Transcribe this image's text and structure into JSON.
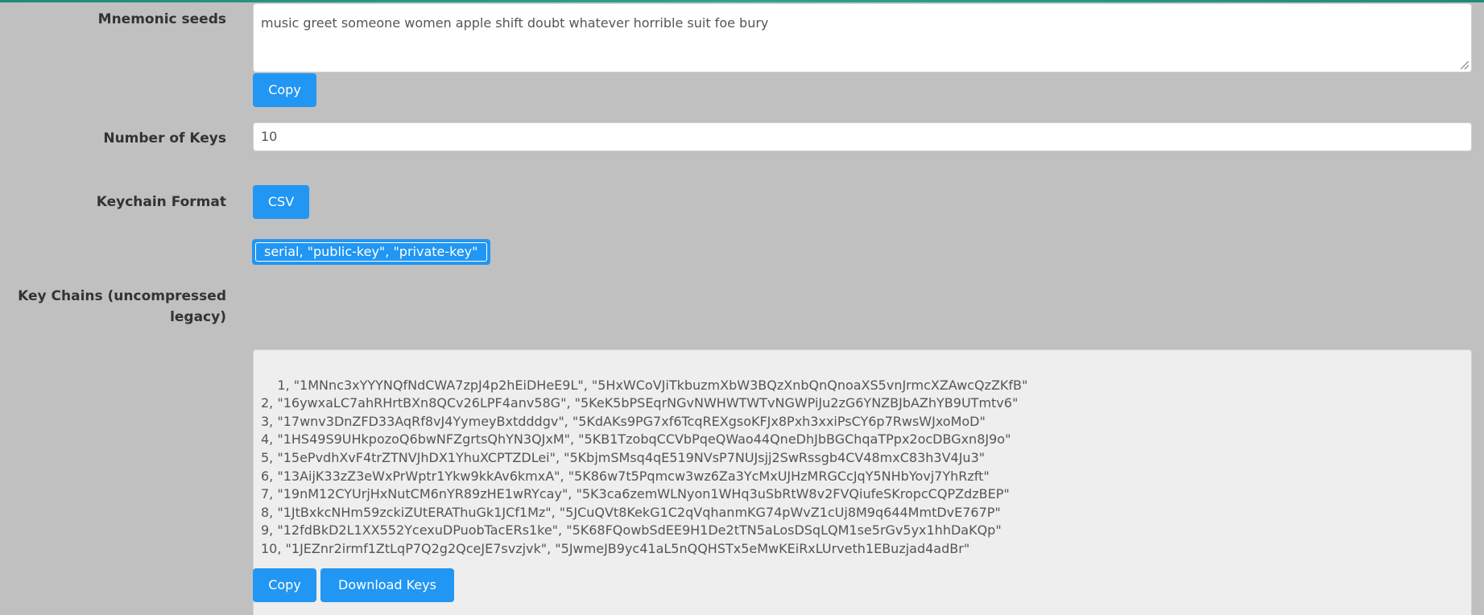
{
  "mnemonic": {
    "label": "Mnemonic seeds",
    "value": "music greet someone women apple shift doubt whatever horrible suit foe bury",
    "copy_label": "Copy"
  },
  "num_keys": {
    "label": "Number of Keys",
    "value": "10"
  },
  "keychain_format": {
    "label": "Keychain Format",
    "format_button": "CSV",
    "columns_option": "serial, \"public-key\", \"private-key\""
  },
  "key_chains": {
    "label_line1": "Key Chains (uncompressed",
    "label_line2": "legacy)",
    "value": "1, \"1MNnc3xYYYNQfNdCWA7zpJ4p2hEiDHeE9L\", \"5HxWCoVJiTkbuzmXbW3BQzXnbQnQnoaXS5vnJrmcXZAwcQzZKfB\"\n2, \"16ywxaLC7ahRHrtBXn8QCv26LPF4anv58G\", \"5KeK5bPSEqrNGvNWHWTWTvNGWPiJu2zG6YNZBJbAZhYB9UTmtv6\"\n3, \"17wnv3DnZFD33AqRf8vJ4YymeyBxtdddgv\", \"5KdAKs9PG7xf6TcqREXgsoKFJx8Pxh3xxiPsCY6p7RwsWJxoMoD\"\n4, \"1HS49S9UHkpozoQ6bwNFZgrtsQhYN3QJxM\", \"5KB1TzobqCCVbPqeQWao44QneDhJbBGChqaTPpx2ocDBGxn8J9o\"\n5, \"15ePvdhXvF4trZTNVJhDX1YhuXCPTZDLei\", \"5KbjmSMsq4qE519NVsP7NUJsjj2SwRssgb4CV48mxC83h3V4Ju3\"\n6, \"13AijK33zZ3eWxPrWptr1Ykw9kkAv6kmxA\", \"5K86w7t5Pqmcw3wz6Za3YcMxUJHzMRGCcJqY5NHbYovj7YhRzft\"\n7, \"19nM12CYUrjHxNutCM6nYR89zHE1wRYcay\", \"5K3ca6zemWLNyon1WHq3uSbRtW8v2FVQiufeSKropcCQPZdzBEP\"\n8, \"1JtBxkcNHm59zckiZUtERAThuGk1JCf1Mz\", \"5JCuQVt8KekG1C2qVqhanmKG74pWvZ1cUj8M9q644MmtDvE767P\"\n9, \"12fdBkD2L1XX552YcexuDPuobTacERs1ke\", \"5K68FQowbSdEE9H1De2tTN5aLosDSqLQM1se5rGv5yx1hhDaKQp\"\n10, \"1JEZnr2irmf1ZtLqP7Q2g2QceJE7svzjvk\", \"5JwmeJB9yc41aL5nQQHSTx5eMwKEiRxLUrveth1EBuzjad4adBr\"",
    "copy_label": "Copy",
    "download_label": "Download Keys"
  },
  "colors": {
    "background": "#c0c0c0",
    "accent": "#2196f3",
    "readonly_bg": "#eeeeee"
  }
}
